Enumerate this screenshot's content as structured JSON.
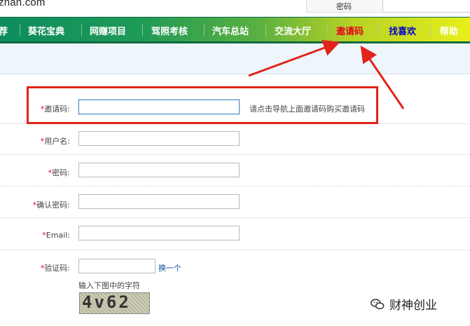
{
  "header": {
    "logo_text": "zhan.com",
    "password_label": "密码"
  },
  "nav": {
    "items": [
      {
        "label": "荐",
        "kind": "normal"
      },
      {
        "label": "葵花宝典",
        "kind": "normal"
      },
      {
        "label": "网赚项目",
        "kind": "normal"
      },
      {
        "label": "驾照考核",
        "kind": "normal"
      },
      {
        "label": "汽车总站",
        "kind": "normal"
      },
      {
        "label": "交流大厅",
        "kind": "normal"
      },
      {
        "label": "邀请码",
        "kind": "invite"
      },
      {
        "label": "找喜欢",
        "kind": "fav"
      },
      {
        "label": "帮助",
        "kind": "help"
      }
    ]
  },
  "form": {
    "required_mark": "*",
    "invite_label": "邀请码:",
    "invite_hint": "请点击导航上面邀请码购买邀请码",
    "invite_value": "",
    "username_label": "用户名:",
    "username_value": "",
    "password_label": "密码:",
    "password_value": "",
    "confirm_label": "确认密码:",
    "confirm_value": "",
    "email_label": "Email:",
    "email_value": "",
    "captcha_label": "验证码:",
    "captcha_value": "",
    "refresh_link": "换一个",
    "captcha_hint": "输入下图中的字符",
    "captcha_text": "4v62"
  },
  "watermark": {
    "text": "财神创业",
    "icon": "wechat-icon"
  },
  "colors": {
    "highlight": "#e2231a",
    "invite_nav": "#e8001c",
    "fav_nav": "#0000cc",
    "link": "#0c4f9e"
  }
}
